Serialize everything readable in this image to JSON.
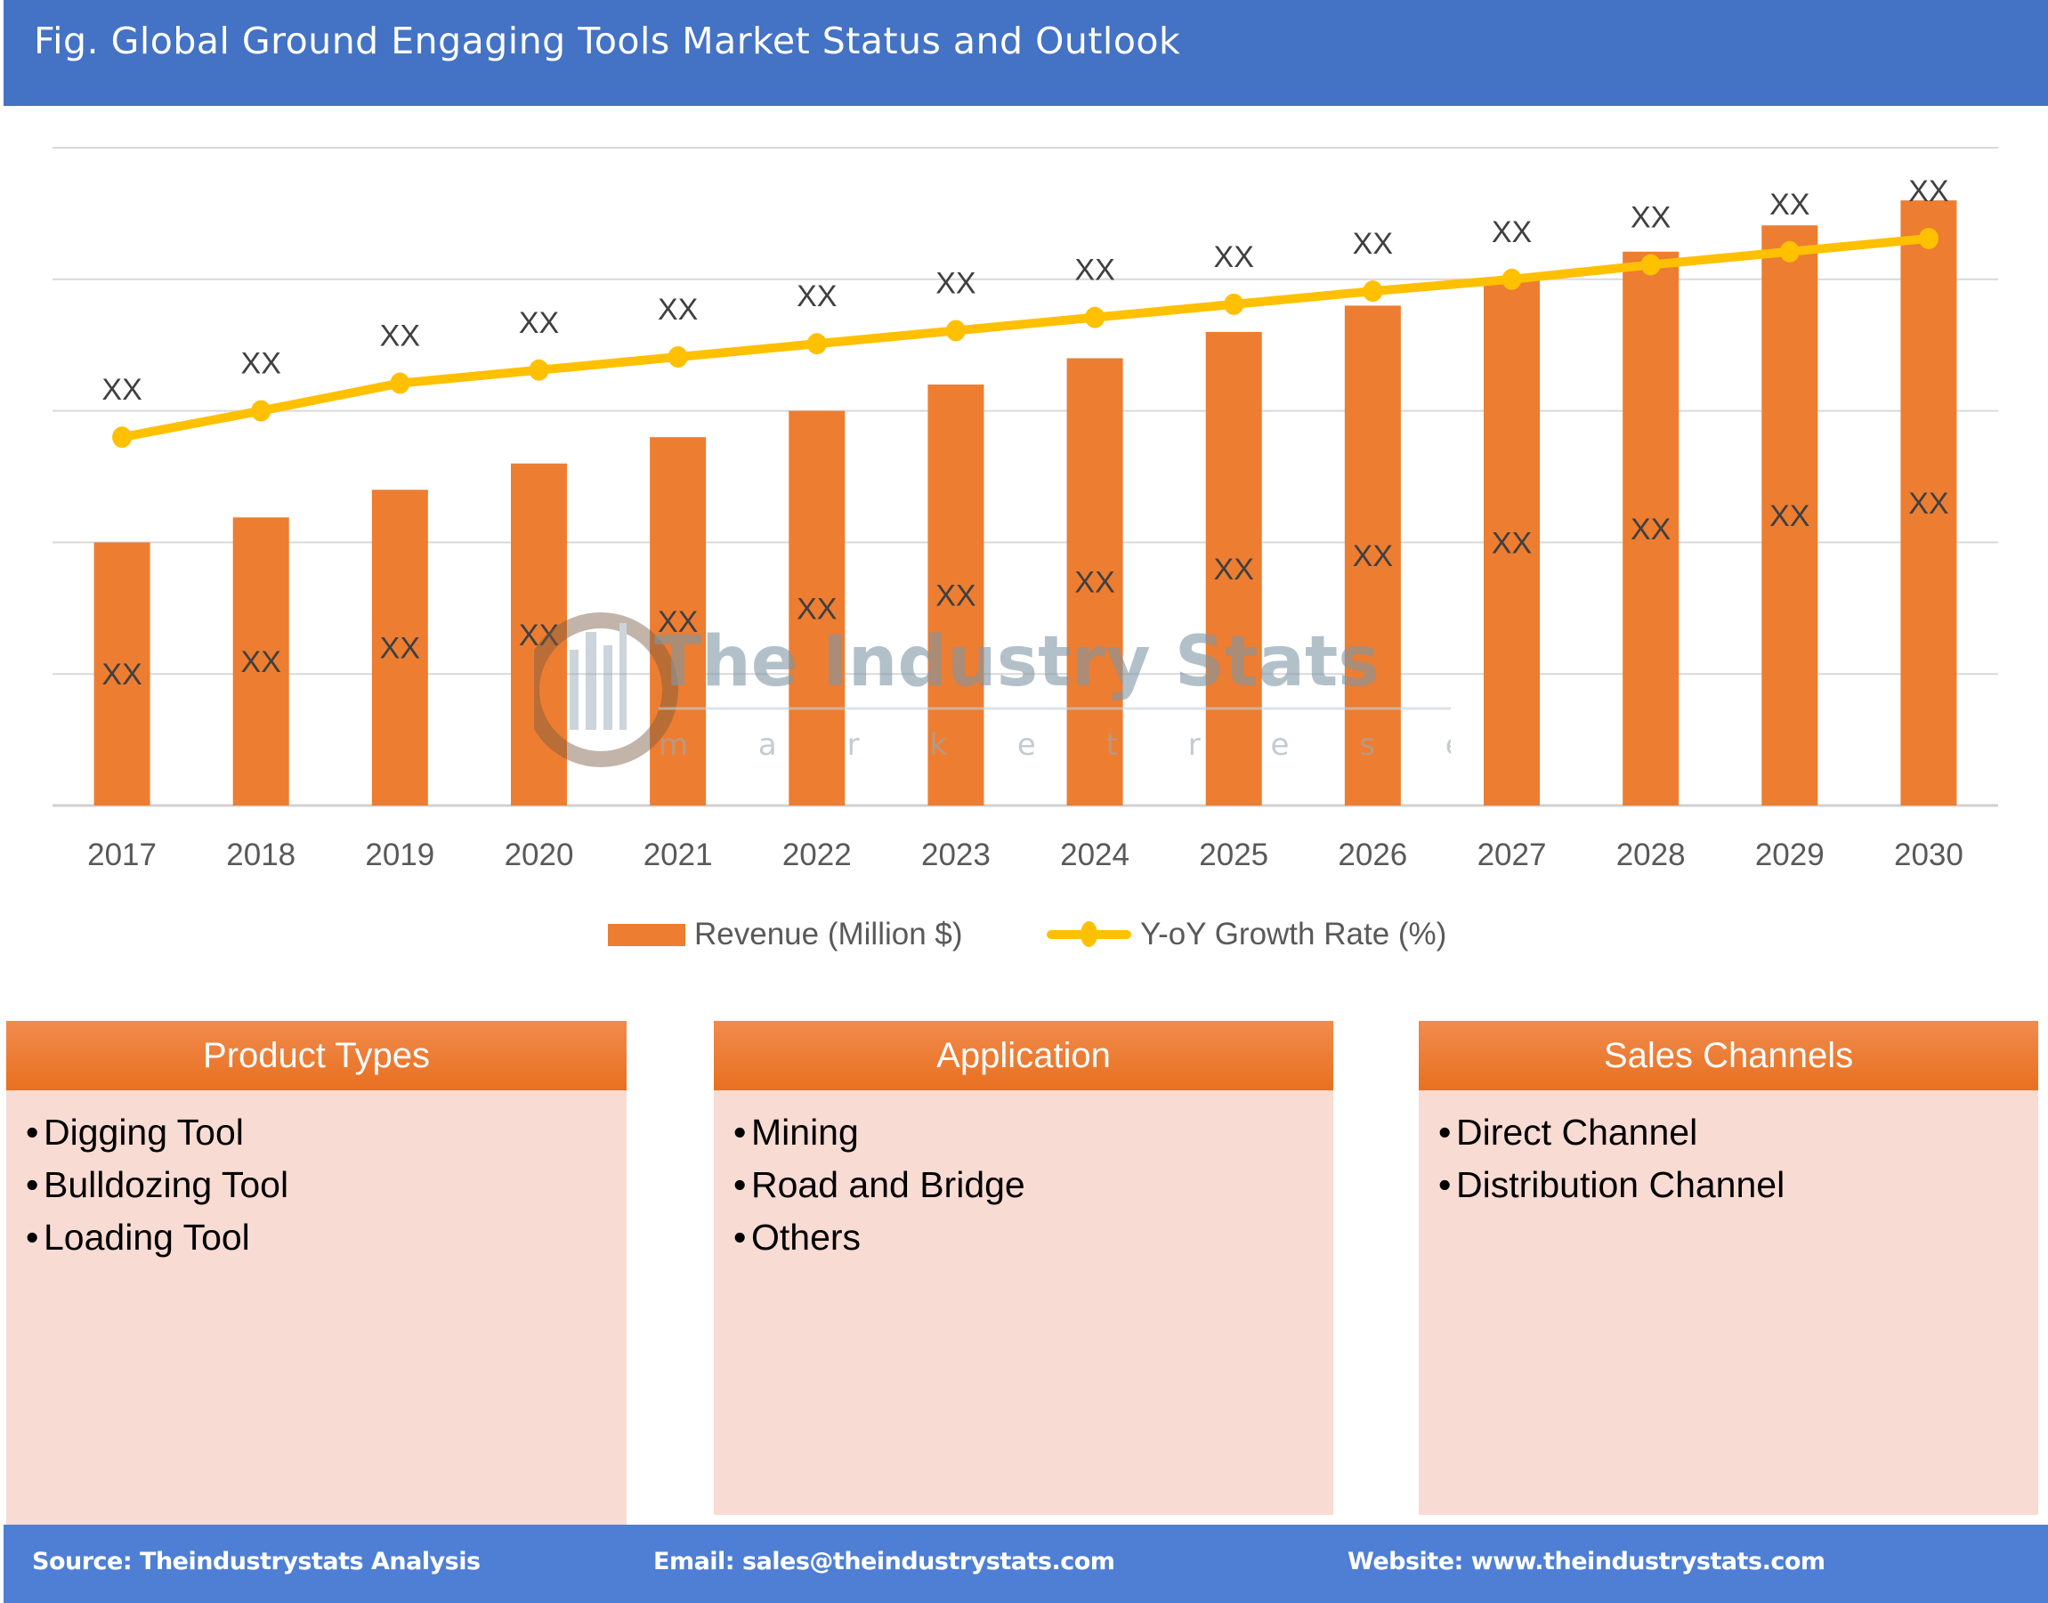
{
  "header": {
    "title": "Fig. Global Ground Engaging Tools Market Status and Outlook"
  },
  "chart_data": {
    "type": "bar",
    "title": "Fig. Global Ground Engaging Tools Market Status and Outlook",
    "xlabel": "",
    "ylabel": "",
    "categories": [
      "2017",
      "2018",
      "2019",
      "2020",
      "2021",
      "2022",
      "2023",
      "2024",
      "2025",
      "2026",
      "2027",
      "2028",
      "2029",
      "2030"
    ],
    "series": [
      {
        "name": "Revenue (Million $)",
        "type": "bar",
        "color": "#ED7D31",
        "values": [
          2.0,
          2.19,
          2.4,
          2.6,
          2.8,
          3.0,
          3.2,
          3.4,
          3.6,
          3.8,
          4.0,
          4.21,
          4.41,
          4.6
        ],
        "data_labels": [
          "XX",
          "XX",
          "XX",
          "XX",
          "XX",
          "XX",
          "XX",
          "XX",
          "XX",
          "XX",
          "XX",
          "XX",
          "XX",
          "XX"
        ]
      },
      {
        "name": "Y-oY Growth Rate (%)",
        "type": "line",
        "color": "#FFC000",
        "values": [
          2.8,
          3.0,
          3.21,
          3.31,
          3.41,
          3.51,
          3.61,
          3.71,
          3.81,
          3.91,
          4.0,
          4.11,
          4.21,
          4.31
        ],
        "data_labels": [
          "XX",
          "XX",
          "XX",
          "XX",
          "XX",
          "XX",
          "XX",
          "XX",
          "XX",
          "XX",
          "XX",
          "XX",
          "XX",
          "XX"
        ]
      }
    ],
    "ylim": [
      0,
      5
    ],
    "y_ticks_shown": false,
    "grid": true,
    "legend_position": "bottom",
    "note": "Values are unlabeled (XX); relative magnitudes estimated from gridlines"
  },
  "legend": {
    "revenue": "Revenue (Million $)",
    "growth": "Y-oY Growth Rate (%)"
  },
  "watermark": {
    "title": "The Industry Stats",
    "subtitle": "m a r k e t   r e s e a r c h"
  },
  "panels": [
    {
      "title": "Product Types",
      "items": [
        "Digging Tool",
        "Bulldozing Tool",
        "Loading Tool"
      ]
    },
    {
      "title": "Application",
      "items": [
        "Mining",
        "Road and Bridge",
        "Others"
      ]
    },
    {
      "title": "Sales Channels",
      "items": [
        "Direct Channel",
        "Distribution Channel"
      ]
    }
  ],
  "footer": {
    "source": "Source: Theindustrystats Analysis",
    "email": "Email: sales@theindustrystats.com",
    "website": "Website: www.theindustrystats.com"
  },
  "bullet": "•"
}
